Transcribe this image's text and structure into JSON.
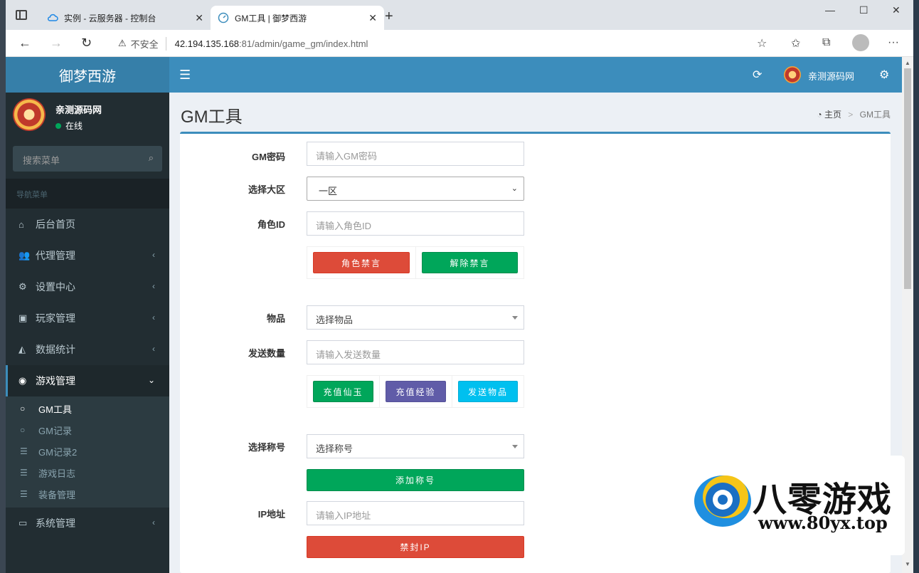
{
  "browser": {
    "tabs": [
      {
        "title": "实例 - 云服务器 - 控制台",
        "icon": "cloud-icon"
      },
      {
        "title": "GM工具 | 御梦西游",
        "icon": "dashboard-icon"
      }
    ],
    "insecure_label": "不安全",
    "url_host": "42.194.135.168",
    "url_rest": ":81/admin/game_gm/index.html"
  },
  "app": {
    "logo": "御梦西游",
    "user": "亲测源码网"
  },
  "sidebar": {
    "user_name": "亲测源码网",
    "status": "在线",
    "search_placeholder": "搜索菜单",
    "header": "导航菜单",
    "items": [
      {
        "label": "后台首页",
        "icon": "home-icon"
      },
      {
        "label": "代理管理",
        "icon": "users-icon"
      },
      {
        "label": "设置中心",
        "icon": "cogs-icon"
      },
      {
        "label": "玩家管理",
        "icon": "contact-icon"
      },
      {
        "label": "数据统计",
        "icon": "area-chart-icon"
      },
      {
        "label": "游戏管理",
        "icon": "gamepad-icon"
      },
      {
        "label": "系统管理",
        "icon": "desktop-icon"
      }
    ],
    "subitems": [
      {
        "label": "GM工具",
        "icon": "circle-icon"
      },
      {
        "label": "GM记录",
        "icon": "circle-icon"
      },
      {
        "label": "GM记录2",
        "icon": "list-icon"
      },
      {
        "label": "游戏日志",
        "icon": "list-icon"
      },
      {
        "label": "装备管理",
        "icon": "list-icon"
      }
    ]
  },
  "page": {
    "title": "GM工具",
    "breadcrumb_home": "主页",
    "breadcrumb_current": "GM工具"
  },
  "form": {
    "gm_password_label": "GM密码",
    "gm_password_placeholder": "请输入GM密码",
    "server_label": "选择大区",
    "server_value": "一区",
    "role_id_label": "角色ID",
    "role_id_placeholder": "请输入角色ID",
    "mute_btn": "角色禁言",
    "unmute_btn": "解除禁言",
    "item_label": "物品",
    "item_value": "选择物品",
    "qty_label": "发送数量",
    "qty_placeholder": "请输入发送数量",
    "recharge_jade_btn": "充值仙玉",
    "recharge_exp_btn": "充值经验",
    "send_item_btn": "发送物品",
    "title_label": "选择称号",
    "title_value": "选择称号",
    "add_title_btn": "添加称号",
    "ip_label": "IP地址",
    "ip_placeholder": "请输入IP地址",
    "ban_ip_btn": "禁封IP"
  },
  "watermark": {
    "title": "八零游戏",
    "url": "www.80yx.top"
  }
}
